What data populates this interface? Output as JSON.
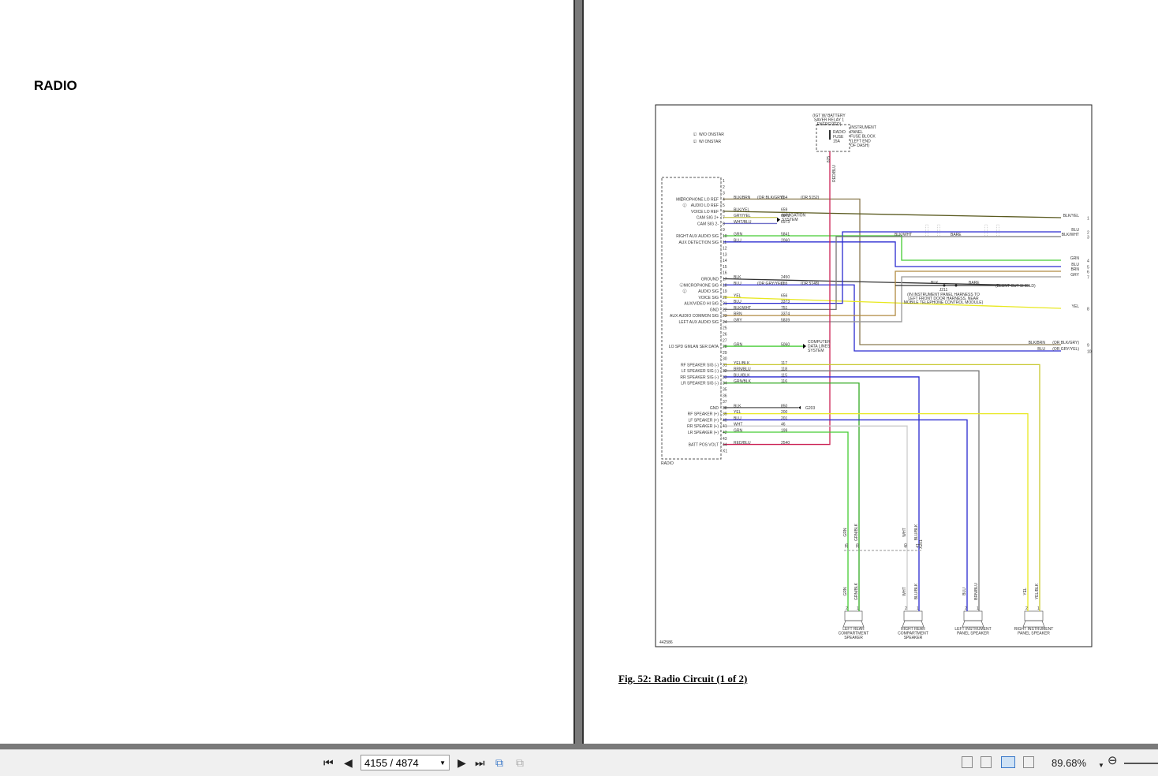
{
  "document": {
    "section_title": "RADIO",
    "figure_caption": "Fig. 52: Radio Circuit (1 of 2)"
  },
  "diagram": {
    "legend": [
      "W/O ONSTAR",
      "W/ ONSTAR"
    ],
    "legend_marks": [
      "1",
      "2"
    ],
    "fuse_header": [
      "(IGT W/ BATTERY",
      "SAVER RELAY 1",
      "ENERGIZED)"
    ],
    "fuse_label": [
      "RADIO",
      "FUSE",
      "15A"
    ],
    "fuse_block": [
      "INSTRUMENT",
      "PANEL",
      "FUSE BLOCK",
      "(LEFT END",
      "OF DASH)"
    ],
    "feed_wire": "RED/BLU",
    "feed_circuit": "825",
    "connector_name": "RADIO",
    "figure_id": "442586",
    "navigation": [
      "NAVIGATION",
      "SYSTEM"
    ],
    "data_lines": [
      "COMPUTER",
      "DATA LINES",
      "SYSTEM"
    ],
    "ground_ref": "G203",
    "splice": "J211",
    "splice_note": [
      "(IN INSTRUMENT PANEL HARNESS TO",
      "LEFT FRONT DOOR HARNESS, NEAR",
      "MOBILE TELEPHONE CONTROL MODULE)"
    ],
    "shield_note": "(BLUNT CUT SHIELD)",
    "bare_label": "BARE",
    "blk_label": "BLK",
    "blkwht_label": "BLK/WHT",
    "pins": [
      {
        "pin": "1"
      },
      {
        "pin": "2"
      },
      {
        "pin": "3"
      },
      {
        "pin": "4",
        "label": "MICROPHONE LO REF",
        "mark": "1",
        "wire": "BLK/BRN",
        "note": "(OR BLK/GRY)",
        "circuit": "654",
        "note2": "(OR 5152)",
        "color": "#8a7a50"
      },
      {
        "pin": "5",
        "label": "AUDIO LO REF",
        "mark": "2"
      },
      {
        "pin": "6",
        "label": "VOICE LO REF",
        "wire": "BLK/YEL",
        "circuit": "659",
        "color": "#5a5a20"
      },
      {
        "pin": "7",
        "label": "CAM SIG 2+",
        "wire": "GRY/YEL",
        "circuit": "6973",
        "color": "#c8c860"
      },
      {
        "pin": "8",
        "label": "CAM SIG 2-",
        "wire": "WHT/BLU",
        "circuit": "6973",
        "color": "#7070c8"
      },
      {
        "pin": "9"
      },
      {
        "pin": "10",
        "label": "RIGHT AUX AUDIO SIG",
        "wire": "GRN",
        "circuit": "5841",
        "color": "#44cc33"
      },
      {
        "pin": "11",
        "label": "AUX DETECTION SIG",
        "wire": "BLU",
        "circuit": "2060",
        "color": "#2a2ad0"
      },
      {
        "pin": "12"
      },
      {
        "pin": "13"
      },
      {
        "pin": "14"
      },
      {
        "pin": "15"
      },
      {
        "pin": "16"
      },
      {
        "pin": "17",
        "label": "GROUND",
        "wire": "BLK",
        "circuit": "2450",
        "color": "#333333"
      },
      {
        "pin": "18",
        "label": "MICROPHONE SIG",
        "mark": "1",
        "wire": "BLU",
        "note": "(OR GRY/YEL)",
        "circuit": "655",
        "note2": "(OR 5148)",
        "color": "#2a2ad0"
      },
      {
        "pin": "19",
        "label": "AUDIO SIG",
        "mark": "2"
      },
      {
        "pin": "20",
        "label": "VOICE SIG",
        "wire": "YEL",
        "circuit": "656",
        "color": "#e8e820"
      },
      {
        "pin": "21",
        "label": "AUX/VIDEO HI SIG",
        "wire": "BLU",
        "circuit": "3373",
        "color": "#2a2ad0"
      },
      {
        "pin": "22",
        "label": "GND",
        "wire": "BLK/WHT",
        "circuit": "751",
        "color": "#777777"
      },
      {
        "pin": "23",
        "label": "AUX AUDIO COMMON SIG",
        "wire": "BRN",
        "circuit": "3374",
        "color": "#b08a40"
      },
      {
        "pin": "24",
        "label": "LEFT AUX AUDIO SIG",
        "wire": "GRY",
        "circuit": "5839",
        "color": "#999999"
      },
      {
        "pin": "25"
      },
      {
        "pin": "26"
      },
      {
        "pin": "27"
      },
      {
        "pin": "28",
        "label": "LO SPD GMLAN SER DATA",
        "wire": "GRN",
        "circuit": "5060",
        "color": "#44cc33"
      },
      {
        "pin": "29"
      },
      {
        "pin": "30"
      },
      {
        "pin": "31",
        "label": "RF SPEAKER SIG (-)",
        "wire": "YEL/BLK",
        "circuit": "117",
        "color": "#c8c830"
      },
      {
        "pin": "32",
        "label": "LF SPEAKER SIG (-)",
        "wire": "BRN/BLU",
        "circuit": "118",
        "color": "#777777"
      },
      {
        "pin": "33",
        "label": "RR SPEAKER SIG (-)",
        "wire": "BLU/BLK",
        "circuit": "115",
        "color": "#2a2ad0"
      },
      {
        "pin": "34",
        "label": "LR SPEAKER SIG (-)",
        "wire": "GRN/BLK",
        "circuit": "116",
        "color": "#33aa22"
      },
      {
        "pin": "35"
      },
      {
        "pin": "36"
      },
      {
        "pin": "37"
      },
      {
        "pin": "38",
        "label": "GND",
        "wire": "BLK",
        "circuit": "850",
        "color": "#555555"
      },
      {
        "pin": "39",
        "label": "RF SPEAKER (+)",
        "wire": "YEL",
        "circuit": "200",
        "color": "#e8e820"
      },
      {
        "pin": "40",
        "label": "LF SPEAKER (+)",
        "wire": "BLU",
        "circuit": "201",
        "color": "#2a2ad0"
      },
      {
        "pin": "41",
        "label": "RR SPEAKER (+)",
        "wire": "WHT",
        "circuit": "46",
        "color": "#cccccc"
      },
      {
        "pin": "42",
        "label": "LR SPEAKER (+)",
        "wire": "GRN",
        "circuit": "199",
        "color": "#44cc33"
      },
      {
        "pin": "43"
      },
      {
        "pin": "44",
        "label": "BATT POS VOLT",
        "wire": "RED/BLU",
        "circuit": "2540",
        "color": "#cc2255"
      },
      {
        "pin": "X1"
      }
    ],
    "outputs": [
      {
        "num": "1",
        "wire": "BLK/YEL"
      },
      {
        "num": "2",
        "wire": "BLU"
      },
      {
        "num": "3",
        "wire": "BLK/WHT"
      },
      {
        "num": "4",
        "wire": "GRN"
      },
      {
        "num": "5",
        "wire": "BLU"
      },
      {
        "num": "6",
        "wire": "BRN"
      },
      {
        "num": "7",
        "wire": "GRY"
      },
      {
        "num": "8",
        "wire": "YEL"
      },
      {
        "num": "9",
        "wire": "BLK/BRN",
        "note": "(OR BLK/GRY)"
      },
      {
        "num": "10",
        "wire": "BLU",
        "note": "(OR GRY/YEL)"
      }
    ],
    "speakers": [
      {
        "name": [
          "LEFT REAR",
          "COMPARTMENT",
          "SPEAKER"
        ],
        "wires": [
          "GRN",
          "GRN/BLK"
        ],
        "upper_wires": [
          "GRN",
          "GRN/BLK"
        ],
        "conn_pins": [
          "35",
          "39"
        ],
        "colors": [
          "#44cc33",
          "#33aa22"
        ]
      },
      {
        "name": [
          "RIGHT REAR",
          "COMPARTMENT",
          "SPEAKER"
        ],
        "wires": [
          "WHT",
          "BLU/BLK"
        ],
        "upper_wires": [
          "WHT",
          "BLU/BLK"
        ],
        "conn_pins": [
          "40",
          "41"
        ],
        "conn_name": "X201",
        "colors": [
          "#cccccc",
          "#2a2ad0"
        ]
      },
      {
        "name": [
          "LEFT INSTRUMENT",
          "PANEL SPEAKER"
        ],
        "wires": [
          "BLU",
          "BRN/BLU"
        ],
        "colors": [
          "#2a2ad0",
          "#777777"
        ]
      },
      {
        "name": [
          "RIGHT INSTRUMENT",
          "PANEL SPEAKER"
        ],
        "wires": [
          "YEL",
          "YEL/BLK"
        ],
        "colors": [
          "#e8e820",
          "#c8c830"
        ]
      }
    ],
    "speaker_pin_labels": [
      "2",
      "1"
    ]
  },
  "toolbar": {
    "page_indicator": "4155 / 4874",
    "zoom": "89.68%",
    "icons": [
      "first-page-icon",
      "prev-page-icon",
      "next-page-icon",
      "last-page-icon",
      "prev-view-icon",
      "next-view-icon"
    ]
  }
}
